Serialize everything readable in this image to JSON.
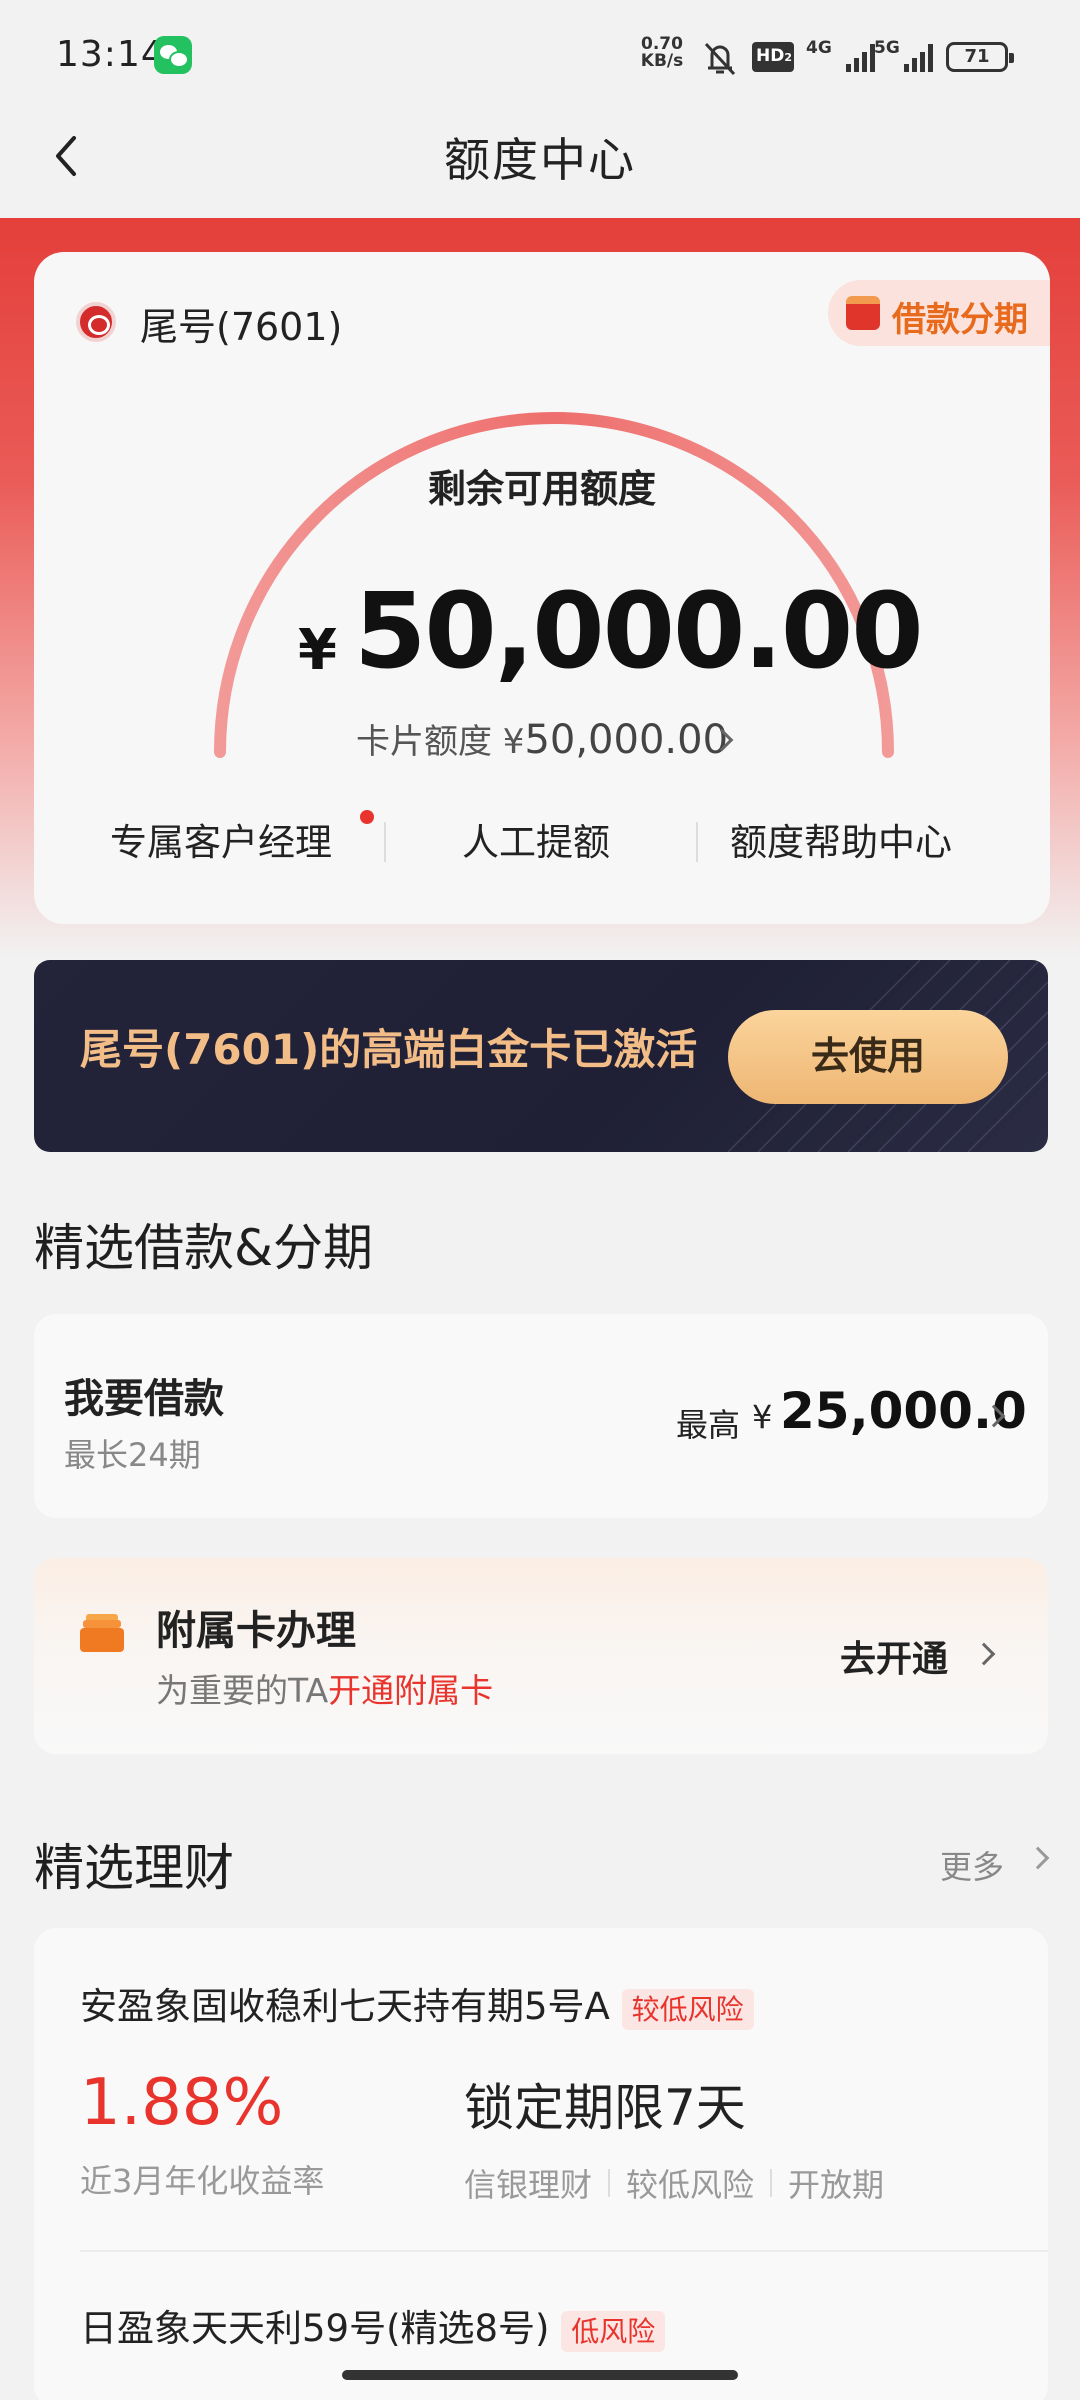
{
  "status_bar": {
    "time": "13:14",
    "net_speed_value": "0.70",
    "net_speed_unit": "KB/s",
    "hd_label": "HD",
    "hd_sub": "2",
    "sig1_label": "4G",
    "sig2_label": "5G",
    "battery": "71"
  },
  "nav": {
    "title": "额度中心"
  },
  "quota_card": {
    "card_tail": "尾号(7601)",
    "badge_label": "借款分期",
    "remain_label": "剩余可用额度",
    "currency": "¥",
    "amount": "50,000.00",
    "card_limit_label": "卡片额度 ¥",
    "card_limit_value": "50,000.00",
    "actions": [
      "专属客户经理",
      "人工提额",
      "额度帮助中心"
    ]
  },
  "banner": {
    "text": "尾号(7601)的高端白金卡已激活",
    "button": "去使用"
  },
  "loan_section": {
    "title": "精选借款&分期",
    "loan_title": "我要借款",
    "loan_sub": "最长24期",
    "max_label": "最高",
    "currency": "¥",
    "max_amount": "25,000.0"
  },
  "supp_card": {
    "title": "附属卡办理",
    "sub_prefix": "为重要的TA",
    "sub_highlight": "开通附属卡",
    "open_label": "去开通"
  },
  "wealth_section": {
    "title": "精选理财",
    "more": "更多",
    "products": [
      {
        "name": "安盈象固收稳利七天持有期5号A",
        "risk": "较低风险",
        "yield": "1.88%",
        "yield_label": "近3月年化收益率",
        "period": "锁定期限7天",
        "tags": [
          "信银理财",
          "较低风险",
          "开放期"
        ]
      },
      {
        "name": "日盈象天天利59号(精选8号)",
        "risk": "低风险"
      }
    ]
  },
  "colors": {
    "brand_red": "#e8342c",
    "banner_gold": "#f3bd88",
    "badge_orange": "#e86a1d"
  },
  "icons": [
    "back-icon",
    "wechat-icon",
    "mute-icon",
    "bank-logo-icon",
    "gift-icon",
    "chevron-right-icon",
    "card-stack-icon"
  ]
}
